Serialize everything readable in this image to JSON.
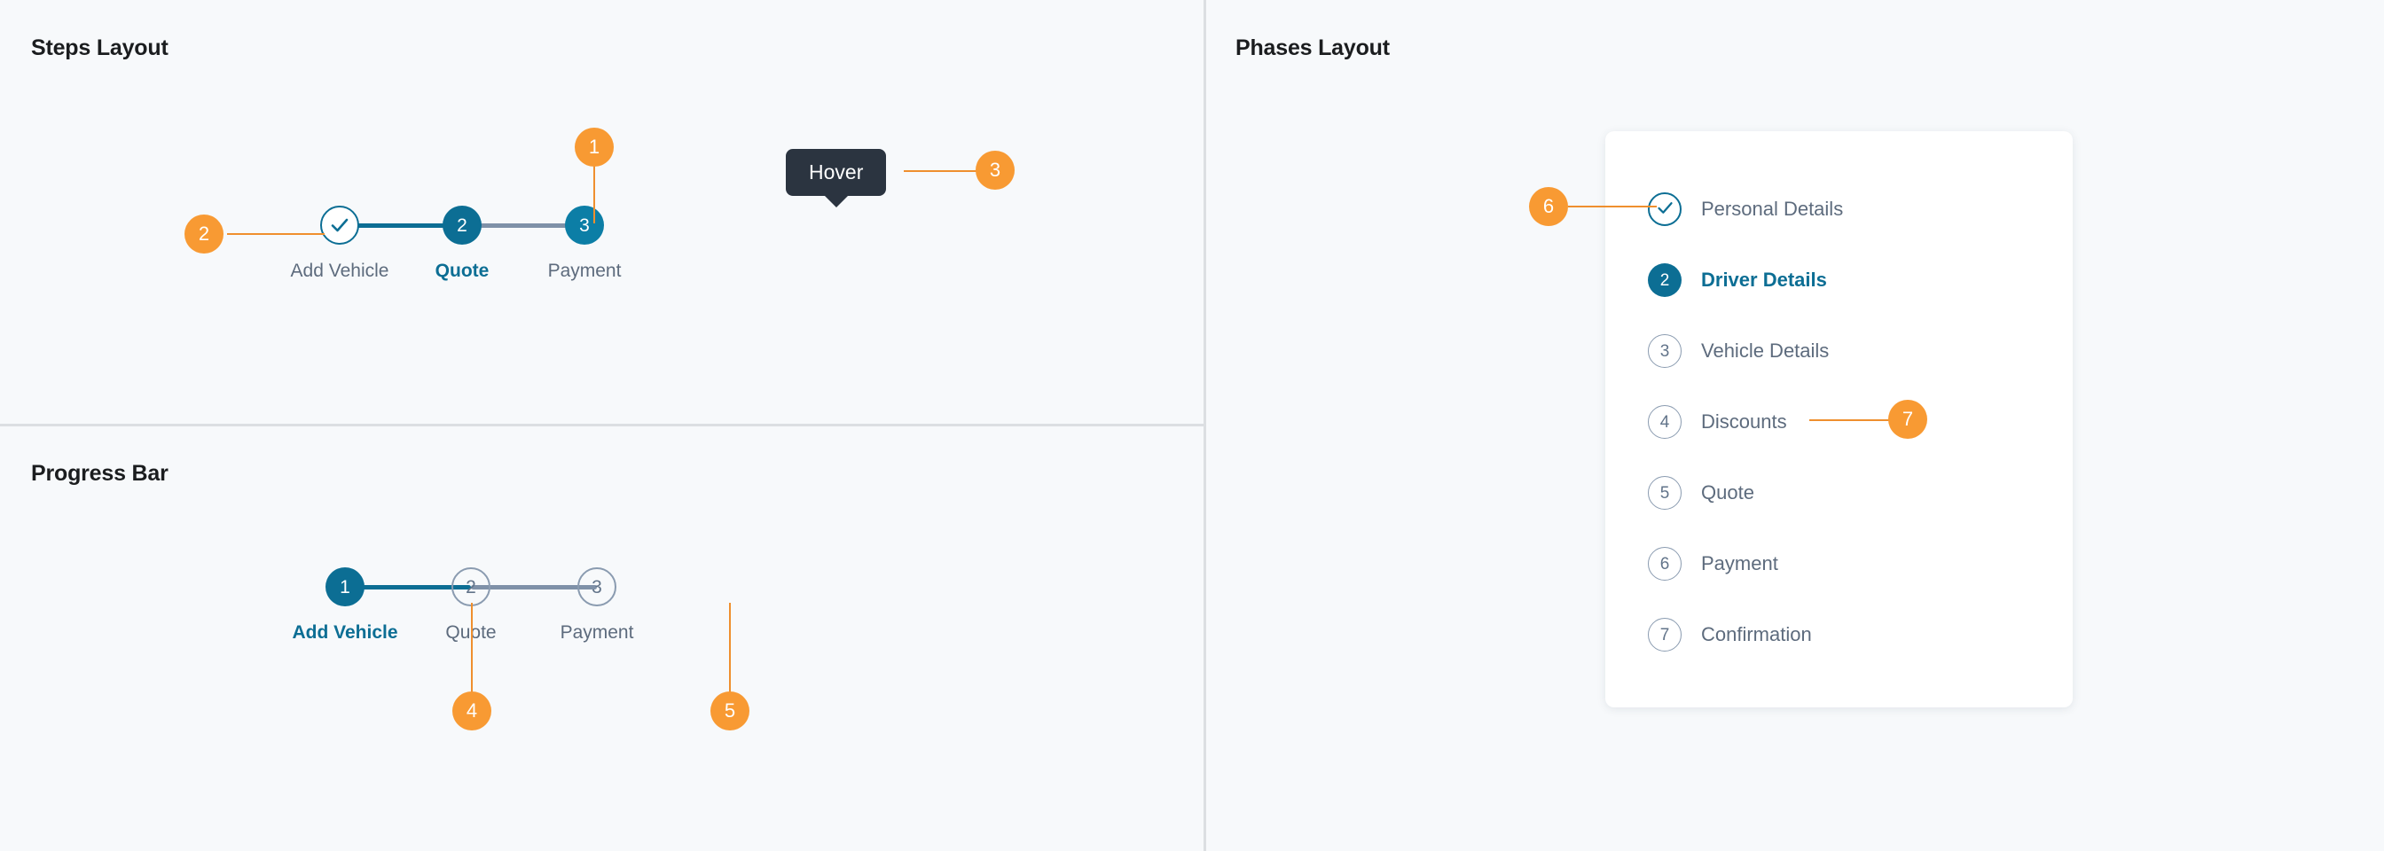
{
  "sections": {
    "steps": {
      "title": "Steps Layout"
    },
    "progress": {
      "title": "Progress Bar"
    },
    "phases": {
      "title": "Phases Layout"
    }
  },
  "colors": {
    "background": "#f7f9fb",
    "accent_teal": "#0c6e94",
    "accent_orange": "#f89a33",
    "muted_gray": "#7f91a8",
    "label_gray": "#5d6b7d",
    "tooltip_dark": "#2b3440",
    "card_white": "#ffffff",
    "divider": "#dcdfe2"
  },
  "steps_layout": {
    "steps": [
      {
        "number": "1",
        "label": "Add Vehicle",
        "state": "done",
        "icon": "check-icon"
      },
      {
        "number": "2",
        "label": "Quote",
        "state": "active"
      },
      {
        "number": "3",
        "label": "Payment",
        "state": "upcoming-filled"
      }
    ],
    "connectors": [
      {
        "state": "filled"
      },
      {
        "state": "empty"
      }
    ],
    "tooltip": {
      "text": "Hover",
      "attached_to": "Payment"
    }
  },
  "progress_bar": {
    "steps": [
      {
        "number": "1",
        "label": "Add Vehicle",
        "state": "active"
      },
      {
        "number": "2",
        "label": "Quote",
        "state": "upcoming"
      },
      {
        "number": "3",
        "label": "Payment",
        "state": "upcoming"
      }
    ],
    "connectors": [
      {
        "state": "filled"
      },
      {
        "state": "empty"
      }
    ]
  },
  "phases_layout": {
    "phases": [
      {
        "number": "1",
        "label": "Personal Details",
        "state": "done",
        "icon": "check-icon"
      },
      {
        "number": "2",
        "label": "Driver Details",
        "state": "active"
      },
      {
        "number": "3",
        "label": "Vehicle Details",
        "state": "upcoming"
      },
      {
        "number": "4",
        "label": "Discounts",
        "state": "upcoming"
      },
      {
        "number": "5",
        "label": "Quote",
        "state": "upcoming"
      },
      {
        "number": "6",
        "label": "Payment",
        "state": "upcoming"
      },
      {
        "number": "7",
        "label": "Confirmation",
        "state": "upcoming"
      }
    ]
  },
  "annotations": [
    {
      "id": "1",
      "label": "1",
      "target": "steps-active-circle"
    },
    {
      "id": "2",
      "label": "2",
      "target": "steps-completed-circle"
    },
    {
      "id": "3",
      "label": "3",
      "target": "steps-tooltip"
    },
    {
      "id": "4",
      "label": "4",
      "target": "progress-filled-connector"
    },
    {
      "id": "5",
      "label": "5",
      "target": "progress-empty-connector"
    },
    {
      "id": "6",
      "label": "6",
      "target": "phases-completed-circle"
    },
    {
      "id": "7",
      "label": "7",
      "target": "phases-discounts-row"
    }
  ]
}
